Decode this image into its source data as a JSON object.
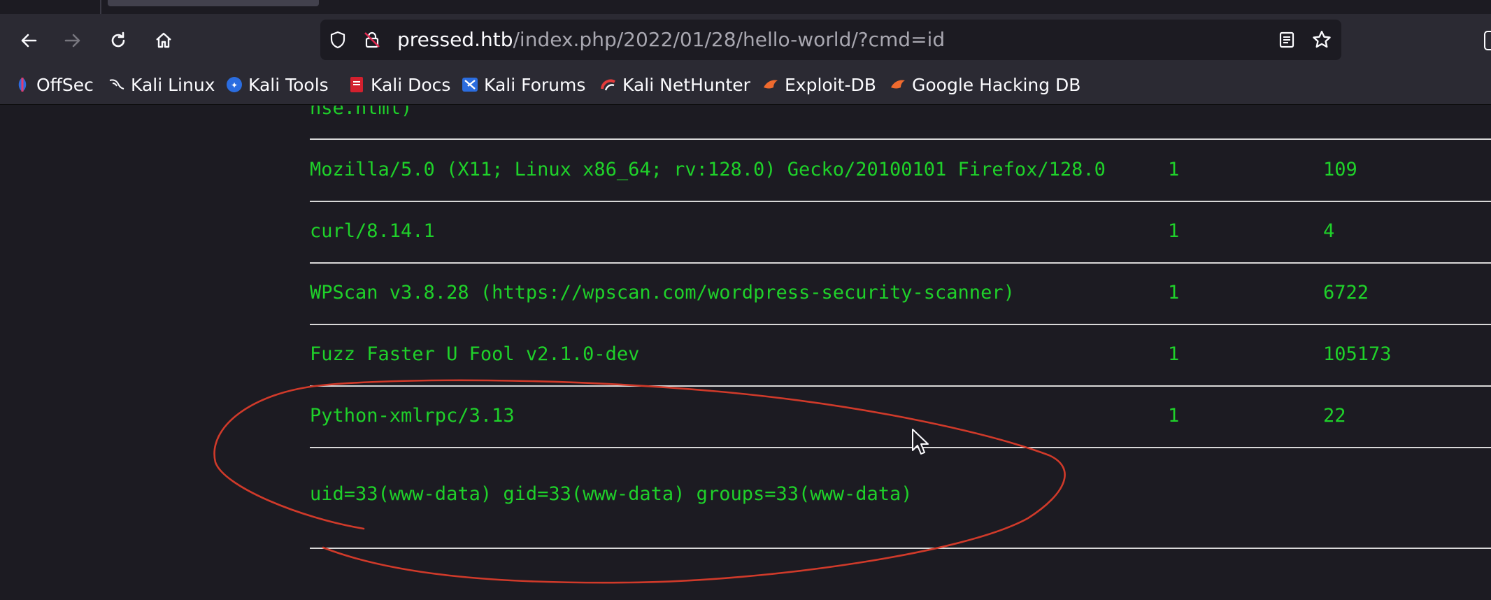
{
  "browser": {
    "url_host": "pressed.htb",
    "url_path": "/index.php/2022/01/28/hello-world/?cmd=id"
  },
  "bookmarks": [
    {
      "label": "OffSec",
      "icon": "offsec-icon"
    },
    {
      "label": "Kali Linux",
      "icon": "kali-dragon-icon"
    },
    {
      "label": "Kali Tools",
      "icon": "kali-tools-icon"
    },
    {
      "label": "Kali Docs",
      "icon": "kali-docs-icon"
    },
    {
      "label": "Kali Forums",
      "icon": "kali-forums-icon"
    },
    {
      "label": "Kali NetHunter",
      "icon": "kali-nethunter-icon"
    },
    {
      "label": "Exploit-DB",
      "icon": "exploit-db-icon"
    },
    {
      "label": "Google Hacking DB",
      "icon": "ghdb-icon"
    }
  ],
  "page": {
    "partial_text": "nse.html)",
    "rows": [
      {
        "agent": "Mozilla/5.0 (X11; Linux x86_64; rv:128.0) Gecko/20100101 Firefox/128.0",
        "col2": "1",
        "col3": "109"
      },
      {
        "agent": "curl/8.14.1",
        "col2": "1",
        "col3": "4"
      },
      {
        "agent": "WPScan v3.8.28 (https://wpscan.com/wordpress-security-scanner)",
        "col2": "1",
        "col3": "6722"
      },
      {
        "agent": "Fuzz Faster U Fool v2.1.0-dev",
        "col2": "1",
        "col3": "105173"
      },
      {
        "agent": "Python-xmlrpc/3.13",
        "col2": "1",
        "col3": "22"
      }
    ],
    "command_output": "uid=33(www-data) gid=33(www-data) groups=33(www-data)"
  },
  "colors": {
    "terminal_green": "#1fd12a",
    "annotation_red": "#d03a2a",
    "page_bg": "#1c1b22"
  }
}
